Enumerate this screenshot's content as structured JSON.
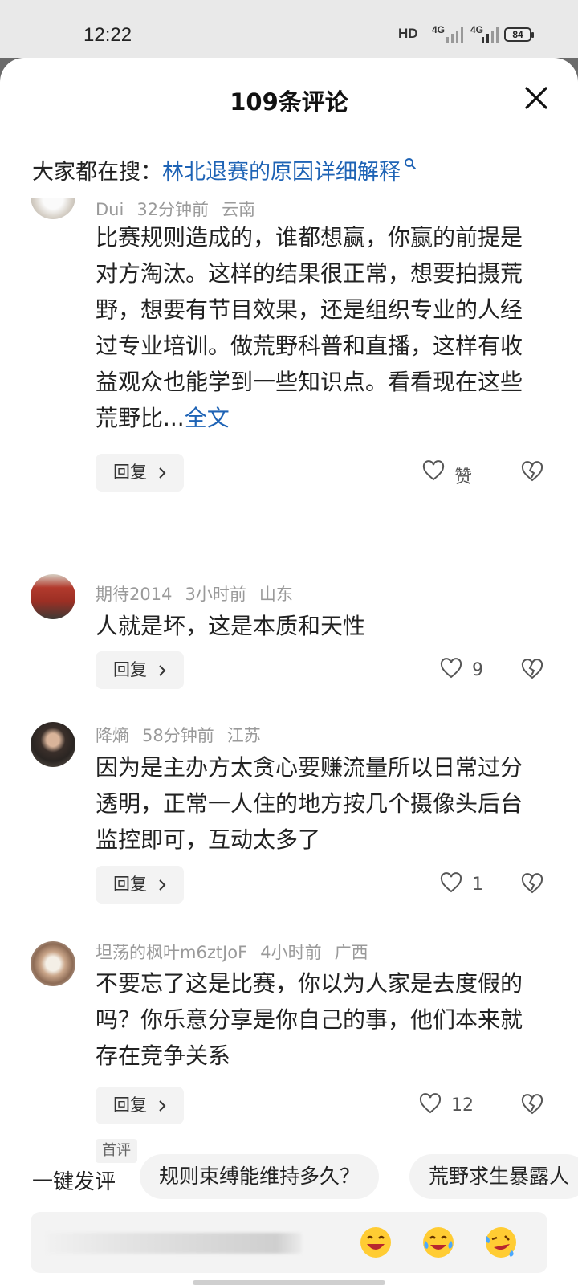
{
  "status_bar": {
    "time": "12:22",
    "hd": "HD",
    "net1": "4G",
    "net2": "4G",
    "battery": "84"
  },
  "header": {
    "title": "109条评论"
  },
  "hot_search": {
    "label": "大家都在搜：",
    "keyword": "林北退赛的原因详细解释"
  },
  "comments": [
    {
      "user": "Dui",
      "time": "32分钟前",
      "location": "云南",
      "text": "比赛规则造成的，谁都想赢，你赢的前提是对方淘汰。这样的结果很正常，想要拍摄荒野，想要有节目效果，还是组织专业的人经过专业培训。做荒野科普和直播，这样有收益观众也能学到一些知识点。看看现在这些荒野比...",
      "more": "全文",
      "reply": "回复",
      "likes": "赞"
    },
    {
      "user": "期待2014",
      "time": "3小时前",
      "location": "山东",
      "text": "人就是坏，这是本质和天性",
      "reply": "回复",
      "likes": "9"
    },
    {
      "user": "降熵",
      "time": "58分钟前",
      "location": "江苏",
      "text": "因为是主办方太贪心要赚流量所以日常过分透明，正常一人住的地方按几个摄像头后台监控即可，互动太多了",
      "reply": "回复",
      "likes": "1"
    },
    {
      "user": "坦荡的枫叶m6ztJoF",
      "time": "4小时前",
      "location": "广西",
      "text": "不要忘了这是比赛，你以为人家是去度假的吗？你乐意分享是你自己的事，他们本来就存在竞争关系",
      "reply": "回复",
      "likes": "12",
      "badge": "首评"
    }
  ],
  "quick_reply": {
    "label": "一键发评",
    "chips": [
      "规则束缚能维持多久？",
      "荒野求生暴露人"
    ]
  },
  "input": {
    "emojis": [
      "grinning-emoji",
      "crying-laughing-emoji",
      "rolling-laughing-emoji"
    ]
  },
  "colors": {
    "link": "#1e63b5",
    "meta": "#9a9a9a"
  }
}
